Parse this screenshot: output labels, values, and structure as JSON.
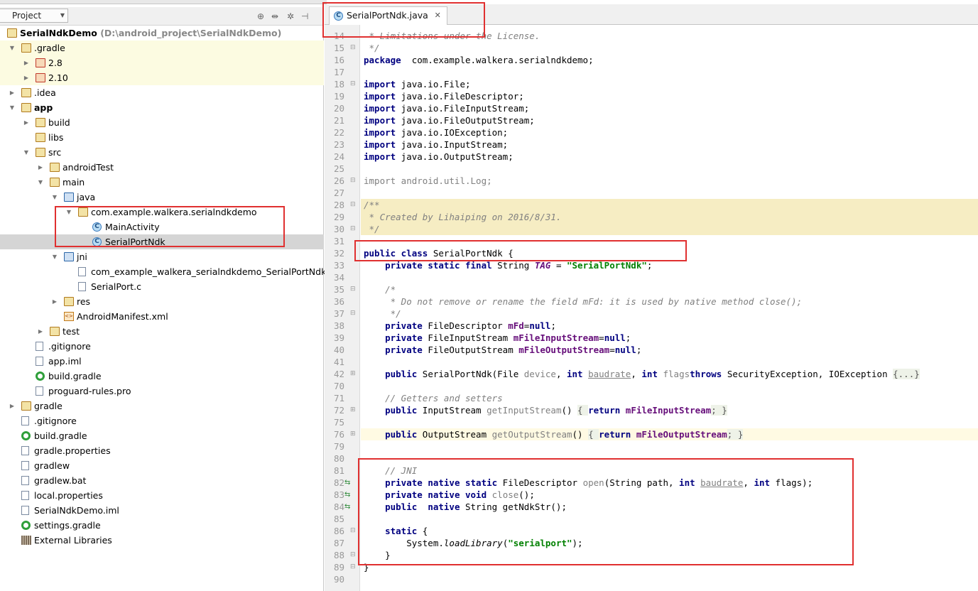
{
  "project_panel": {
    "view_mode": "Project"
  },
  "tree": [
    {
      "depth": 0,
      "label": "SerialNdkDemo",
      "sub": "(D:\\android_project\\SerialNdkDemo)",
      "icon": "module-folder-icon",
      "twisty": "",
      "bold": true
    },
    {
      "depth": 0,
      "label": ".gradle",
      "icon": "folder-icon",
      "twisty": "open",
      "hl": "yel"
    },
    {
      "depth": 1,
      "label": "2.8",
      "icon": "excluded-folder-icon",
      "twisty": "closed",
      "hl": "yel"
    },
    {
      "depth": 1,
      "label": "2.10",
      "icon": "excluded-folder-icon",
      "twisty": "closed",
      "hl": "yel"
    },
    {
      "depth": 0,
      "label": ".idea",
      "icon": "folder-icon",
      "twisty": "closed"
    },
    {
      "depth": 0,
      "label": "app",
      "icon": "module-folder-icon",
      "twisty": "open",
      "bold": true
    },
    {
      "depth": 1,
      "label": "build",
      "icon": "folder-icon",
      "twisty": "closed"
    },
    {
      "depth": 1,
      "label": "libs",
      "icon": "folder-icon",
      "twisty": ""
    },
    {
      "depth": 1,
      "label": "src",
      "icon": "folder-icon",
      "twisty": "open"
    },
    {
      "depth": 2,
      "label": "androidTest",
      "icon": "folder-icon",
      "twisty": "closed"
    },
    {
      "depth": 2,
      "label": "main",
      "icon": "folder-icon",
      "twisty": "open"
    },
    {
      "depth": 3,
      "label": "java",
      "icon": "source-folder-icon",
      "twisty": "open"
    },
    {
      "depth": 4,
      "label": "com.example.walkera.serialndkdemo",
      "icon": "package-icon",
      "twisty": "open"
    },
    {
      "depth": 5,
      "label": "MainActivity",
      "icon": "class-icon",
      "twisty": ""
    },
    {
      "depth": 5,
      "label": "SerialPortNdk",
      "icon": "class-icon",
      "twisty": "",
      "hl": "sel"
    },
    {
      "depth": 3,
      "label": "jni",
      "icon": "source-folder-icon",
      "twisty": "open"
    },
    {
      "depth": 4,
      "label": "com_example_walkera_serialndkdemo_SerialPortNdk.h",
      "icon": "header-file-icon",
      "twisty": ""
    },
    {
      "depth": 4,
      "label": "SerialPort.c",
      "icon": "c-file-icon",
      "twisty": ""
    },
    {
      "depth": 3,
      "label": "res",
      "icon": "resource-folder-icon",
      "twisty": "closed"
    },
    {
      "depth": 3,
      "label": "AndroidManifest.xml",
      "icon": "xml-file-icon",
      "twisty": ""
    },
    {
      "depth": 2,
      "label": "test",
      "icon": "folder-icon",
      "twisty": "closed"
    },
    {
      "depth": 1,
      "label": ".gitignore",
      "icon": "text-file-icon",
      "twisty": ""
    },
    {
      "depth": 1,
      "label": "app.iml",
      "icon": "iml-file-icon",
      "twisty": ""
    },
    {
      "depth": 1,
      "label": "build.gradle",
      "icon": "gradle-file-icon",
      "twisty": ""
    },
    {
      "depth": 1,
      "label": "proguard-rules.pro",
      "icon": "text-file-icon",
      "twisty": ""
    },
    {
      "depth": 0,
      "label": "gradle",
      "icon": "folder-icon",
      "twisty": "closed"
    },
    {
      "depth": 0,
      "label": ".gitignore",
      "icon": "text-file-icon",
      "twisty": ""
    },
    {
      "depth": 0,
      "label": "build.gradle",
      "icon": "gradle-file-icon",
      "twisty": ""
    },
    {
      "depth": 0,
      "label": "gradle.properties",
      "icon": "text-file-icon",
      "twisty": ""
    },
    {
      "depth": 0,
      "label": "gradlew",
      "icon": "text-file-icon",
      "twisty": ""
    },
    {
      "depth": 0,
      "label": "gradlew.bat",
      "icon": "text-file-icon",
      "twisty": ""
    },
    {
      "depth": 0,
      "label": "local.properties",
      "icon": "text-file-icon",
      "twisty": ""
    },
    {
      "depth": 0,
      "label": "SerialNdkDemo.iml",
      "icon": "iml-file-icon",
      "twisty": ""
    },
    {
      "depth": 0,
      "label": "settings.gradle",
      "icon": "gradle-file-icon",
      "twisty": ""
    },
    {
      "depth": 0,
      "label": "External Libraries",
      "icon": "library-icon",
      "twisty": ""
    }
  ],
  "editor": {
    "tab_label": "SerialPortNdk.java",
    "lines": [
      {
        "n": "14",
        "m": "",
        "t": [
          [
            "cm",
            " * Limitations under the License."
          ]
        ]
      },
      {
        "n": "15",
        "m": "fold",
        "t": [
          [
            "cm",
            " */"
          ]
        ]
      },
      {
        "n": "16",
        "m": "",
        "t": [
          [
            "kw",
            "package"
          ],
          [
            "",
            "  com.example.walkera.serialndkdemo;"
          ]
        ]
      },
      {
        "n": "17",
        "m": "",
        "t": []
      },
      {
        "n": "18",
        "m": "fold",
        "t": [
          [
            "kw",
            "import"
          ],
          [
            "",
            " java.io.File;"
          ]
        ]
      },
      {
        "n": "19",
        "m": "",
        "t": [
          [
            "kw",
            "import"
          ],
          [
            "",
            " java.io.FileDescriptor;"
          ]
        ]
      },
      {
        "n": "20",
        "m": "",
        "t": [
          [
            "kw",
            "import"
          ],
          [
            "",
            " java.io.FileInputStream;"
          ]
        ]
      },
      {
        "n": "21",
        "m": "",
        "t": [
          [
            "kw",
            "import"
          ],
          [
            "",
            " java.io.FileOutputStream;"
          ]
        ]
      },
      {
        "n": "22",
        "m": "",
        "t": [
          [
            "kw",
            "import"
          ],
          [
            "",
            " java.io.IOException;"
          ]
        ]
      },
      {
        "n": "23",
        "m": "",
        "t": [
          [
            "kw",
            "import"
          ],
          [
            "",
            " java.io.InputStream;"
          ]
        ]
      },
      {
        "n": "24",
        "m": "",
        "t": [
          [
            "kw",
            "import"
          ],
          [
            "",
            " java.io.OutputStream;"
          ]
        ]
      },
      {
        "n": "25",
        "m": "",
        "t": []
      },
      {
        "n": "26",
        "m": "fold",
        "t": [
          [
            "un",
            "import android.util.Log;"
          ]
        ]
      },
      {
        "n": "27",
        "m": "",
        "t": []
      },
      {
        "n": "28",
        "m": "fold",
        "band": true,
        "t": [
          [
            "cm",
            "/**"
          ]
        ]
      },
      {
        "n": "29",
        "m": "",
        "band": true,
        "t": [
          [
            "cm",
            " * Created by Lihaiping on 2016/8/31."
          ]
        ]
      },
      {
        "n": "30",
        "m": "fold",
        "band": true,
        "t": [
          [
            "cm",
            " */"
          ]
        ]
      },
      {
        "n": "31",
        "m": "",
        "t": []
      },
      {
        "n": "32",
        "m": "",
        "t": [
          [
            "kw",
            "public class"
          ],
          [
            "",
            " SerialPortNdk {"
          ]
        ]
      },
      {
        "n": "33",
        "m": "",
        "t": [
          [
            "",
            "    "
          ],
          [
            "kw",
            "private static final"
          ],
          [
            "",
            " String "
          ],
          [
            "fi",
            "TAG"
          ],
          [
            "",
            " = "
          ],
          [
            "st",
            "\"SerialPortNdk\""
          ],
          [
            "",
            ";"
          ]
        ]
      },
      {
        "n": "34",
        "m": "",
        "t": []
      },
      {
        "n": "35",
        "m": "fold",
        "t": [
          [
            "",
            "    "
          ],
          [
            "cm",
            "/*"
          ]
        ]
      },
      {
        "n": "36",
        "m": "",
        "t": [
          [
            "",
            "    "
          ],
          [
            "cm",
            " * Do not remove or rename the field mFd: it is used by native method close();"
          ]
        ]
      },
      {
        "n": "37",
        "m": "fold",
        "t": [
          [
            "",
            "    "
          ],
          [
            "cm",
            " */"
          ]
        ]
      },
      {
        "n": "38",
        "m": "",
        "t": [
          [
            "",
            "    "
          ],
          [
            "kw",
            "private"
          ],
          [
            "",
            " FileDescriptor "
          ],
          [
            "fv",
            "mFd"
          ],
          [
            "",
            "="
          ],
          [
            "kw",
            "null"
          ],
          [
            "",
            ";"
          ]
        ]
      },
      {
        "n": "39",
        "m": "",
        "t": [
          [
            "",
            "    "
          ],
          [
            "kw",
            "private"
          ],
          [
            "",
            " FileInputStream "
          ],
          [
            "fv",
            "mFileInputStream"
          ],
          [
            "",
            "="
          ],
          [
            "kw",
            "null"
          ],
          [
            "",
            ";"
          ]
        ]
      },
      {
        "n": "40",
        "m": "",
        "t": [
          [
            "",
            "    "
          ],
          [
            "kw",
            "private"
          ],
          [
            "",
            " FileOutputStream "
          ],
          [
            "fv",
            "mFileOutputStream"
          ],
          [
            "",
            "="
          ],
          [
            "kw",
            "null"
          ],
          [
            "",
            ";"
          ]
        ]
      },
      {
        "n": "41",
        "m": "",
        "t": []
      },
      {
        "n": "42",
        "m": "plus",
        "t": [
          [
            "",
            "    "
          ],
          [
            "kw",
            "public"
          ],
          [
            "",
            " SerialPortNdk(File "
          ],
          [
            "pa",
            "device"
          ],
          [
            "",
            ", "
          ],
          [
            "kw",
            "int"
          ],
          [
            "",
            " "
          ],
          [
            "pu",
            "baudrate"
          ],
          [
            "",
            ", "
          ],
          [
            "kw",
            "int"
          ],
          [
            "",
            " "
          ],
          [
            "pa",
            "flags"
          ],
          [
            ") "
          ],
          [
            "kw",
            "throws"
          ],
          [
            "",
            " SecurityException, IOException "
          ],
          [
            "fo",
            "{...}"
          ]
        ]
      },
      {
        "n": "70",
        "m": "",
        "t": []
      },
      {
        "n": "71",
        "m": "",
        "t": [
          [
            "",
            "    "
          ],
          [
            "cm",
            "// Getters and setters"
          ]
        ]
      },
      {
        "n": "72",
        "m": "plus",
        "t": [
          [
            "",
            "    "
          ],
          [
            "kw",
            "public"
          ],
          [
            "",
            " InputStream "
          ],
          [
            "pa",
            "getInputStream"
          ],
          [
            "",
            "() "
          ],
          [
            "fo",
            "{ "
          ],
          [
            "kw",
            "return"
          ],
          [
            "",
            " "
          ],
          [
            "fv",
            "mFileInputStream"
          ],
          [
            "fo",
            "; }"
          ]
        ]
      },
      {
        "n": "75",
        "m": "",
        "t": []
      },
      {
        "n": "76",
        "m": "plus",
        "cur": true,
        "t": [
          [
            "",
            "    "
          ],
          [
            "kw",
            "public"
          ],
          [
            "",
            " OutputStream "
          ],
          [
            "pa",
            "getOutputStream"
          ],
          [
            "",
            "() "
          ],
          [
            "fo",
            "{ "
          ],
          [
            "kw",
            "return"
          ],
          [
            "",
            " "
          ],
          [
            "fv",
            "mFileOutputStream"
          ],
          [
            "fo",
            "; }"
          ]
        ]
      },
      {
        "n": "79",
        "m": "",
        "t": []
      },
      {
        "n": "80",
        "m": "",
        "t": []
      },
      {
        "n": "81",
        "m": "",
        "t": [
          [
            "",
            "    "
          ],
          [
            "cm",
            "// JNI"
          ]
        ]
      },
      {
        "n": "82",
        "m": "native",
        "t": [
          [
            "",
            "    "
          ],
          [
            "kw",
            "private native static"
          ],
          [
            "",
            " FileDescriptor "
          ],
          [
            "pa",
            "open"
          ],
          [
            "",
            "(String path, "
          ],
          [
            "kw",
            "int"
          ],
          [
            "",
            " "
          ],
          [
            "pu",
            "baudrate"
          ],
          [
            "",
            ", "
          ],
          [
            "kw",
            "int"
          ],
          [
            "",
            " flags);"
          ]
        ]
      },
      {
        "n": "83",
        "m": "native",
        "t": [
          [
            "",
            "    "
          ],
          [
            "kw",
            "private native void"
          ],
          [
            "",
            " "
          ],
          [
            "pa",
            "close"
          ],
          [
            "",
            "();"
          ]
        ]
      },
      {
        "n": "84",
        "m": "native",
        "t": [
          [
            "",
            "    "
          ],
          [
            "kw",
            "public  native"
          ],
          [
            "",
            " String getNdkStr();"
          ]
        ]
      },
      {
        "n": "85",
        "m": "",
        "t": []
      },
      {
        "n": "86",
        "m": "fold",
        "t": [
          [
            "",
            "    "
          ],
          [
            "kw",
            "static"
          ],
          [
            "",
            " {"
          ]
        ]
      },
      {
        "n": "87",
        "m": "",
        "t": [
          [
            "",
            "        System."
          ],
          [
            "it",
            "loadLibrary"
          ],
          [
            "",
            "("
          ],
          [
            "st",
            "\"serialport\""
          ],
          [
            "",
            ");"
          ]
        ]
      },
      {
        "n": "88",
        "m": "fold",
        "t": [
          [
            "",
            "    }"
          ]
        ]
      },
      {
        "n": "89",
        "m": "fold",
        "t": [
          [
            "",
            "}"
          ]
        ]
      },
      {
        "n": "90",
        "m": "",
        "t": []
      }
    ]
  },
  "colors": {
    "keyword": "#000080",
    "comment": "#808080",
    "string": "#008000",
    "field": "#660e7a",
    "param": "#808080",
    "annotation_box": "#e03030"
  }
}
